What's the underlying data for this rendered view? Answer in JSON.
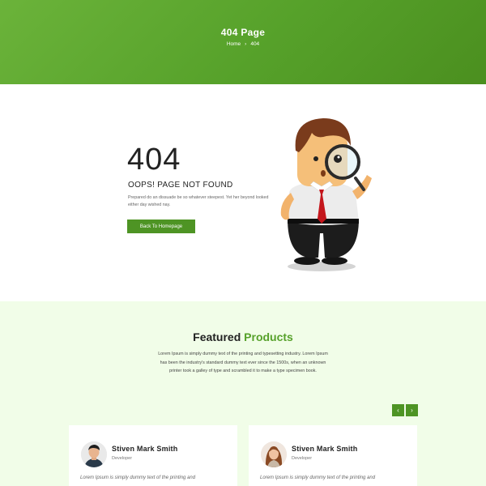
{
  "hero": {
    "title": "404 Page",
    "breadcrumb": {
      "home": "Home",
      "separator": "›",
      "current": "404"
    }
  },
  "error": {
    "code": "404",
    "heading": "OOPS! PAGE NOT FOUND",
    "description": "Prepared do an dissuade be so whatever steepest. Yet her beyond looked either day wished nay.",
    "button_label": "Back To Homepage"
  },
  "featured": {
    "title_plain": "Featured",
    "title_accent": "Products",
    "description": "Lorem Ipsum is simply dummy text of the printing and typesetting industry. Lorem Ipsum has been the industry's standard dummy text ever since the 1500s, when an unknown printer took a galley of type and scrambled it to make a type specimen book.",
    "prev_icon": "‹",
    "next_icon": "›",
    "cards": [
      {
        "name": "Stiven Mark Smith",
        "role": "Developer",
        "text": "Lorem Ipsum is simply dummy text of the printing and"
      },
      {
        "name": "Stiven Mark Smith",
        "role": "Developer",
        "text": "Lorem Ipsum is simply dummy text of the printing and"
      }
    ]
  },
  "colors": {
    "accent": "#56a12a",
    "button": "#4e9424",
    "section_bg": "#f1fde8"
  }
}
